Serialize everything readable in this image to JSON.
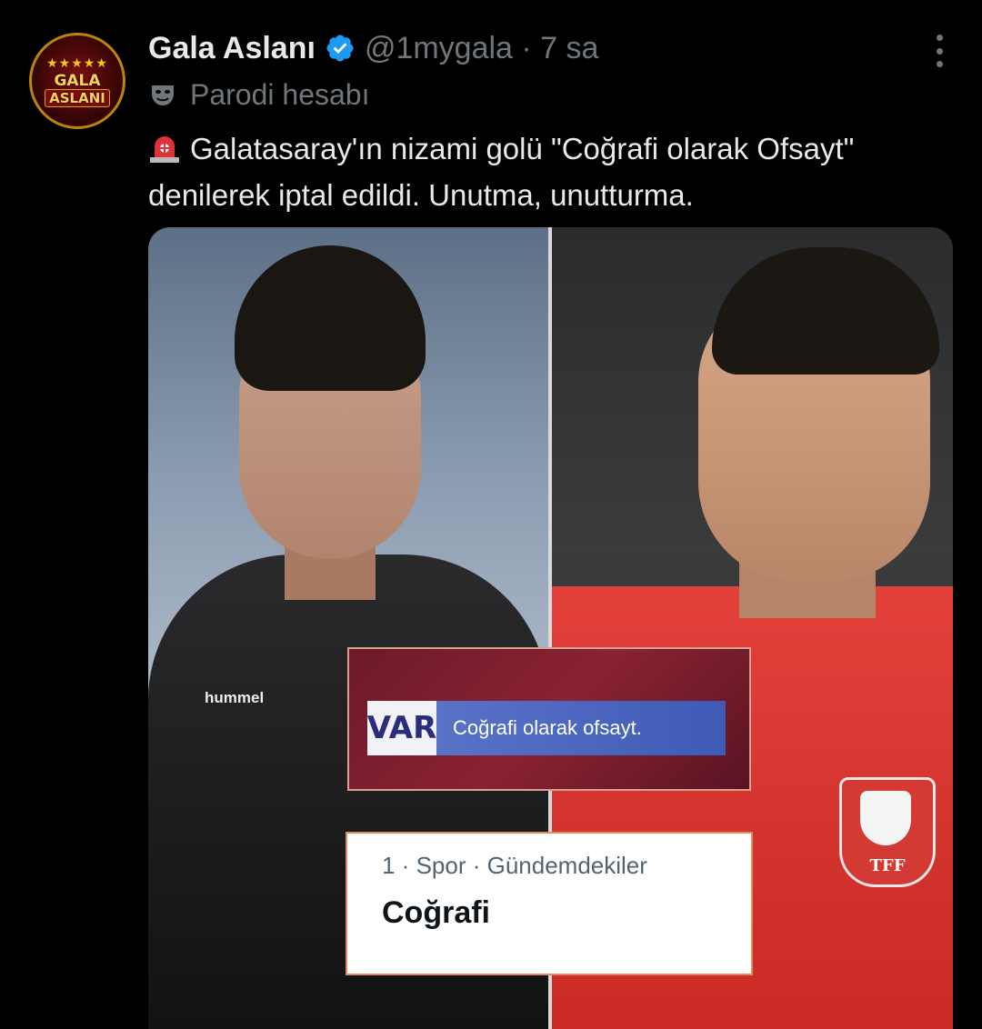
{
  "tweet": {
    "author_name": "Gala Aslanı",
    "handle_time": "@1mygala · 7 sa",
    "parody_label": "Parodi hesabı",
    "text": "Galatasaray'ın nizami golü \"Coğrafi olarak Ofsayt\" denilerek iptal edildi. Unutma, unutturma."
  },
  "avatar": {
    "line1": "GALA",
    "line2": "ASLANI",
    "stars": "★★★★★"
  },
  "media": {
    "var_label": "VAR",
    "var_text": "Coğrafi olarak ofsayt.",
    "trend_meta": "1 · Spor · Gündemdekiler",
    "trend_title": "Coğrafi",
    "shirt_brand": "hummel",
    "badge_text": "TFF"
  },
  "colors": {
    "background": "#000000",
    "text_primary": "#e7e9ea",
    "text_secondary": "#71767b",
    "verified_blue": "#1d9bf0"
  },
  "icons": {
    "verified": "verified-badge-icon",
    "parody": "theater-mask-icon",
    "siren": "siren-emoji-icon",
    "more": "more-options-icon"
  }
}
